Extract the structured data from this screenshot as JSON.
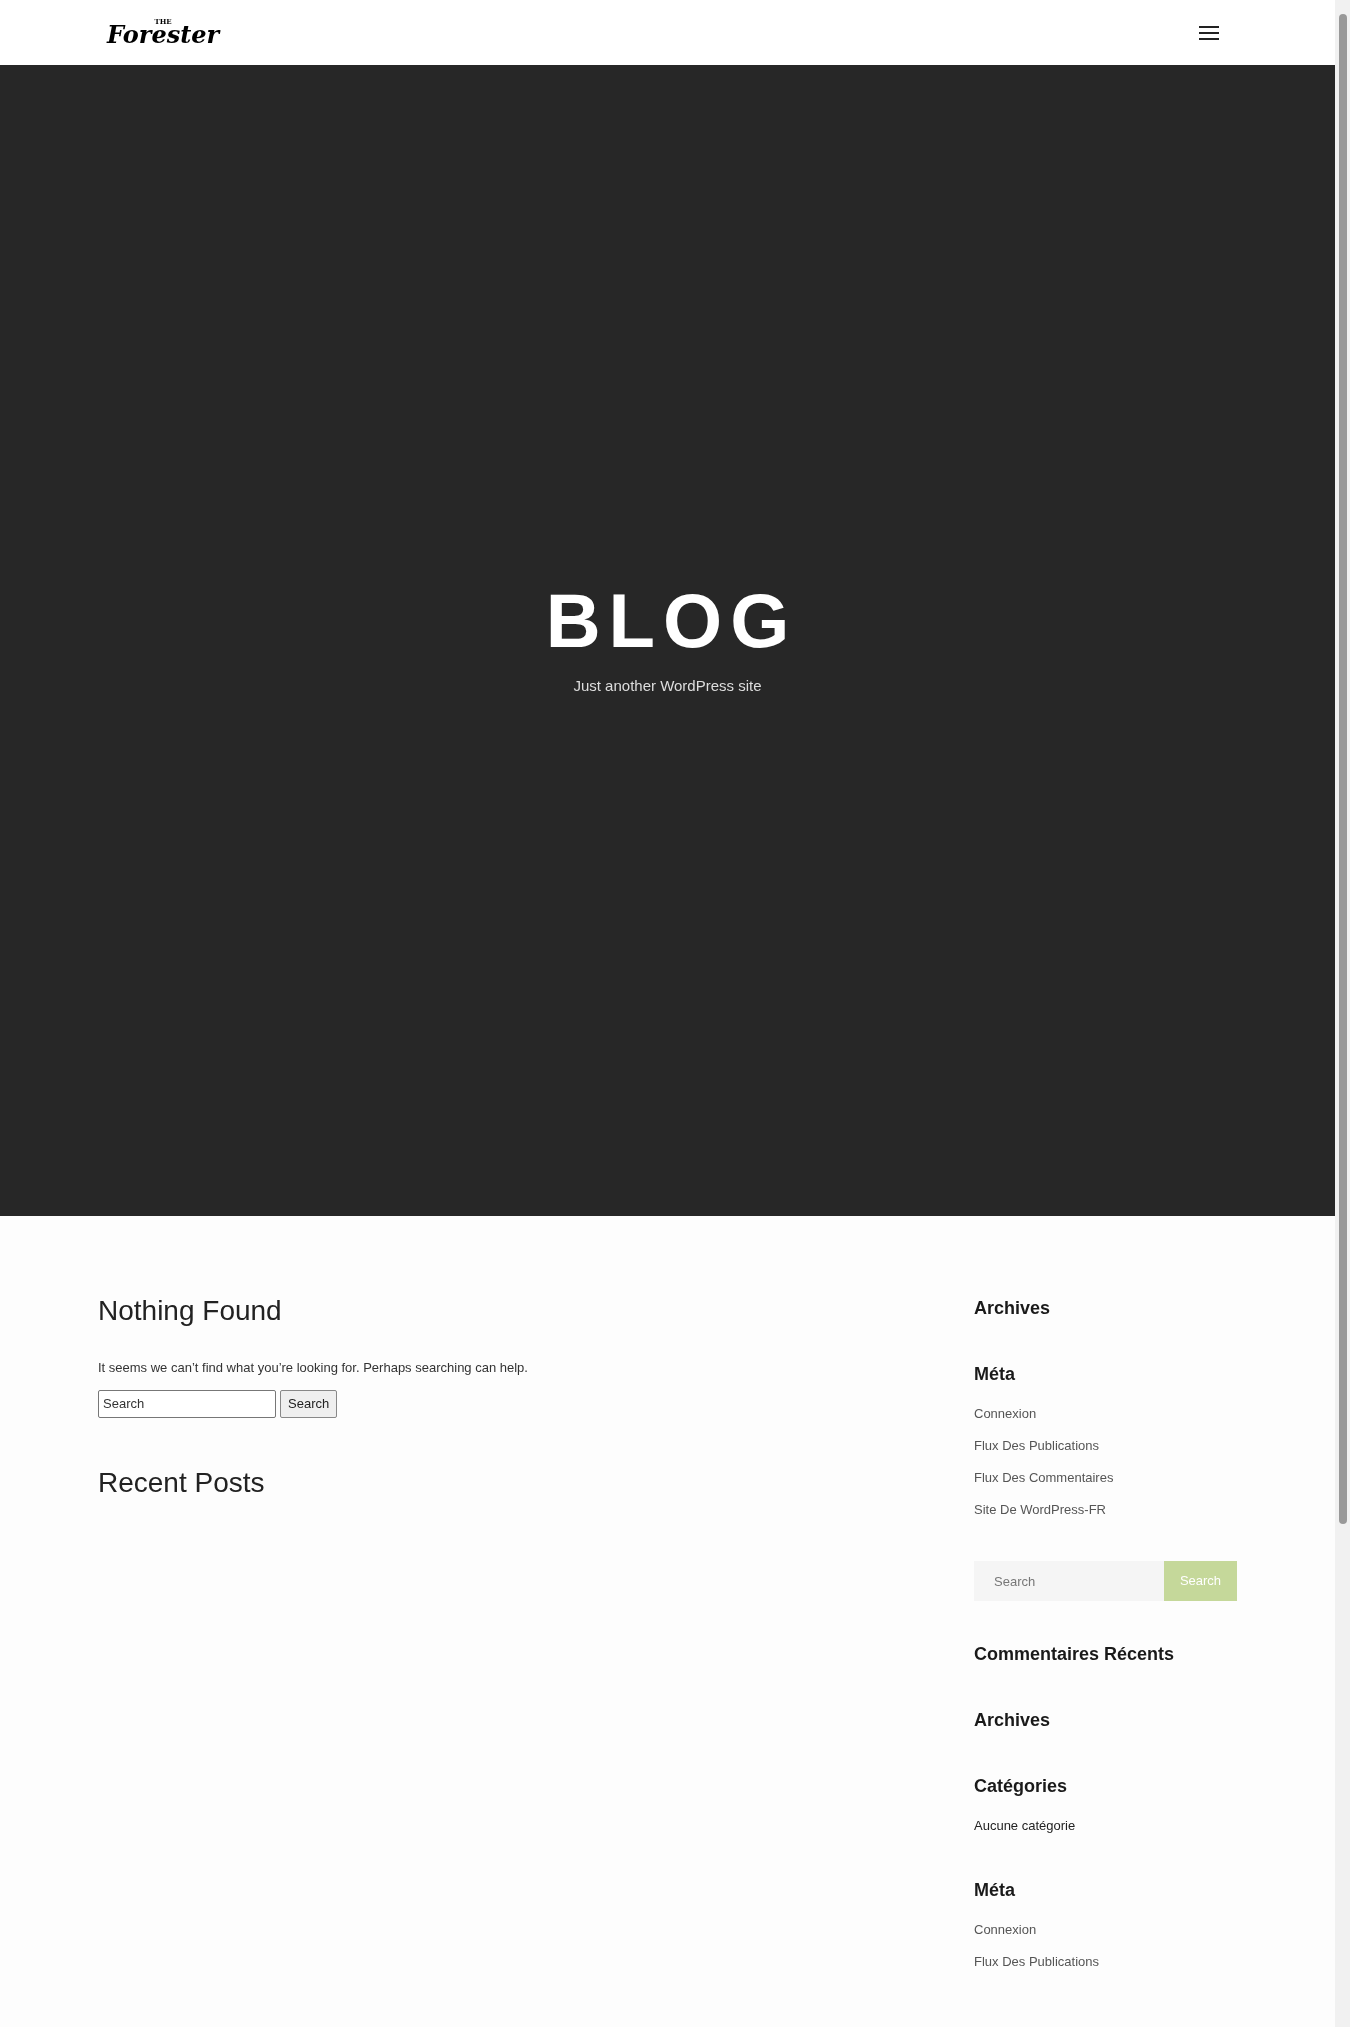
{
  "header": {
    "logo_small": "THE",
    "logo": "Forester"
  },
  "hero": {
    "title": "BLOG",
    "subtitle": "Just another WordPress site"
  },
  "main": {
    "title": "Nothing Found",
    "message": "It seems we can’t find what you’re looking for. Perhaps searching can help.",
    "search": {
      "placeholder": "Search",
      "button": "Search"
    },
    "recent_title": "Recent Posts"
  },
  "sidebar": [
    {
      "kind": "links",
      "title": "Archives"
    },
    {
      "kind": "links",
      "title": "Méta",
      "links": [
        "Connexion",
        "Flux Des Publications",
        "Flux Des Commentaires",
        "Site De WordPress-FR"
      ]
    },
    {
      "kind": "search",
      "placeholder": "Search",
      "button": "Search"
    },
    {
      "kind": "links",
      "title": "Commentaires Récents"
    },
    {
      "kind": "links",
      "title": "Archives"
    },
    {
      "kind": "categories",
      "title": "Catégories",
      "links": [
        "Aucune catégorie"
      ]
    },
    {
      "kind": "links",
      "title": "Méta",
      "links": [
        "Connexion",
        "Flux Des Publications"
      ]
    }
  ]
}
